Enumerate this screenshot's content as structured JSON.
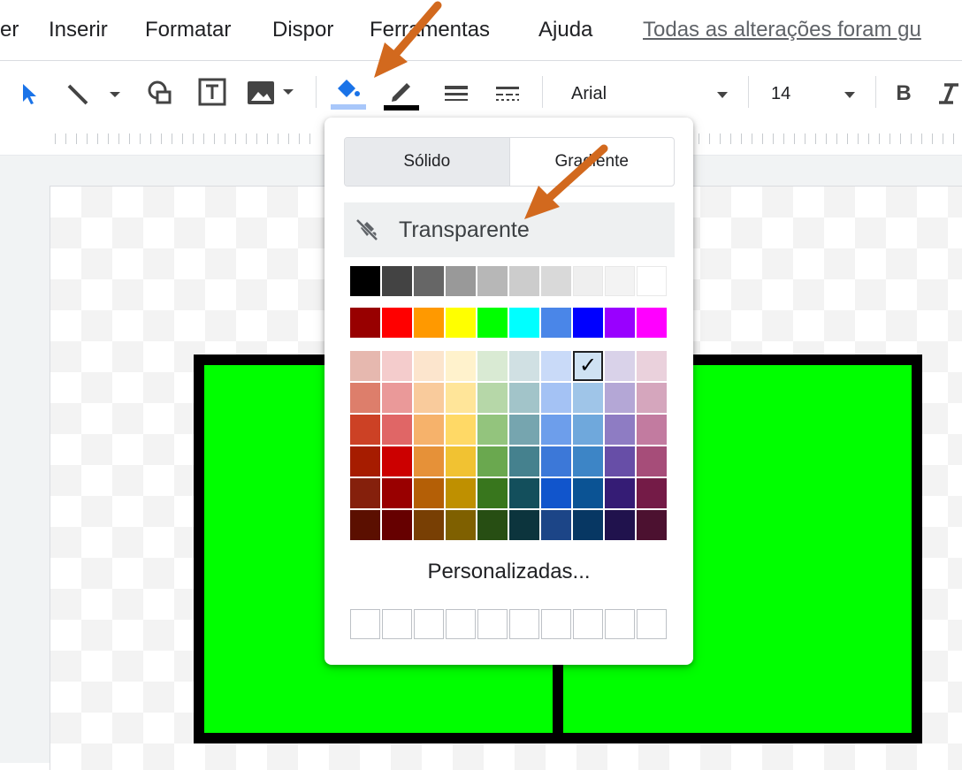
{
  "menubar": {
    "items": [
      {
        "label": "er"
      },
      {
        "label": "Inserir"
      },
      {
        "label": "Formatar"
      },
      {
        "label": "Dispor"
      },
      {
        "label": "Ferramentas"
      },
      {
        "label": "Ajuda"
      }
    ],
    "save_status": "Todas as alterações foram gu"
  },
  "toolbar": {
    "font_family": "Arial",
    "font_size": "14",
    "bold_label": "B",
    "accent_color": "#1a73e8",
    "icons": [
      "select-arrow-icon",
      "line-icon",
      "shape-icon",
      "text-box-icon",
      "image-icon",
      "fill-color-icon",
      "border-color-icon",
      "border-weight-icon",
      "border-dash-icon",
      "bold-icon",
      "italic-icon"
    ]
  },
  "fill_popup": {
    "tabs": [
      {
        "label": "Sólido",
        "active": true
      },
      {
        "label": "Gradiente",
        "active": false
      }
    ],
    "transparent_label": "Transparente",
    "custom_label": "Personalizadas...",
    "selected_check": "✓",
    "grays": [
      "#000000",
      "#434343",
      "#666666",
      "#999999",
      "#b7b7b7",
      "#cccccc",
      "#d9d9d9",
      "#efefef",
      "#f3f3f3",
      "#ffffff"
    ],
    "brights": [
      "#980000",
      "#ff0000",
      "#ff9900",
      "#ffff00",
      "#00ff00",
      "#00ffff",
      "#4a86e8",
      "#0000ff",
      "#9900ff",
      "#ff00ff"
    ],
    "shades": [
      [
        "#e6b8af",
        "#f4cccc",
        "#fce5cd",
        "#fff2cc",
        "#d9ead3",
        "#d0e0e3",
        "#c9daf8",
        "#cfe2f3",
        "#d9d2e9",
        "#ead1dc"
      ],
      [
        "#dd7e6b",
        "#ea9999",
        "#f9cb9c",
        "#ffe599",
        "#b6d7a8",
        "#a2c4c9",
        "#a4c2f4",
        "#9fc5e8",
        "#b4a7d6",
        "#d5a6bd"
      ],
      [
        "#cc4125",
        "#e06666",
        "#f6b26b",
        "#ffd966",
        "#93c47d",
        "#76a5af",
        "#6d9eeb",
        "#6fa8dc",
        "#8e7cc3",
        "#c27ba0"
      ],
      [
        "#a61c00",
        "#cc0000",
        "#e69138",
        "#f1c232",
        "#6aa84f",
        "#45818e",
        "#3c78d8",
        "#3d85c6",
        "#674ea7",
        "#a64d79"
      ],
      [
        "#85200c",
        "#990000",
        "#b45f06",
        "#bf9000",
        "#38761d",
        "#134f5c",
        "#1155cc",
        "#0b5394",
        "#351c75",
        "#741b47"
      ],
      [
        "#5b0f00",
        "#660000",
        "#783f04",
        "#7f6000",
        "#274e13",
        "#0c343d",
        "#1c4587",
        "#073763",
        "#20124d",
        "#4c1130"
      ]
    ],
    "selected_swatch": {
      "row": 0,
      "col": 7
    },
    "custom_slots": 10
  },
  "canvas": {
    "shape_fill": "#00ff00",
    "shape_border": "#000000"
  },
  "annotation_color": "#d2691e"
}
